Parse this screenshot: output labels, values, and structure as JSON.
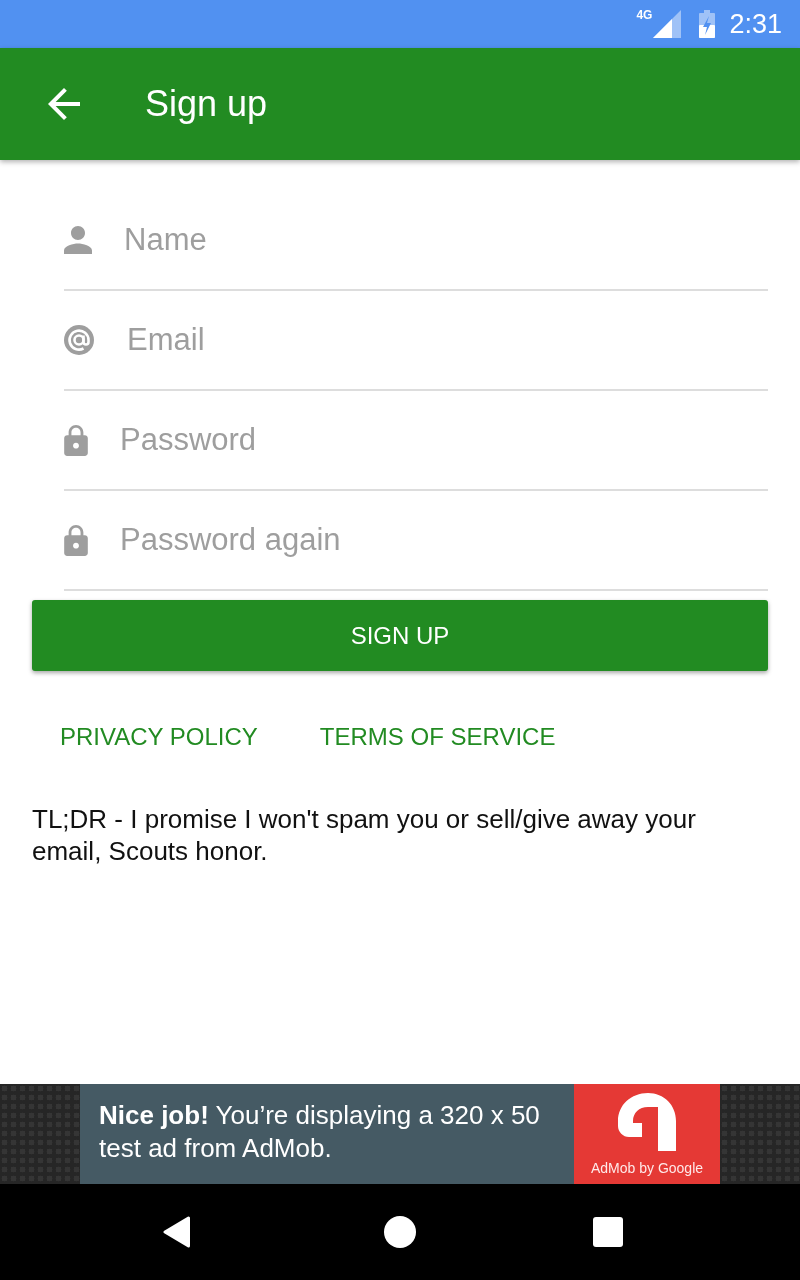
{
  "status_bar": {
    "network": "4G",
    "time": "2:31"
  },
  "app_bar": {
    "title": "Sign up"
  },
  "form": {
    "fields": [
      {
        "kind": "name",
        "placeholder": "Name"
      },
      {
        "kind": "email",
        "placeholder": "Email"
      },
      {
        "kind": "password",
        "placeholder": "Password"
      },
      {
        "kind": "password",
        "placeholder": "Password again"
      }
    ]
  },
  "submit_button": {
    "label": "SIGN UP"
  },
  "links": [
    "PRIVACY POLICY",
    "TERMS OF SERVICE"
  ],
  "note": "TL;DR - I promise I won't spam you or sell/give away your email, Scouts honor.",
  "ad_banner": {
    "message": "**Nice job!** You’re displaying a 320 x 50 test ad from AdMob.",
    "brand": "AdMob by Google"
  }
}
